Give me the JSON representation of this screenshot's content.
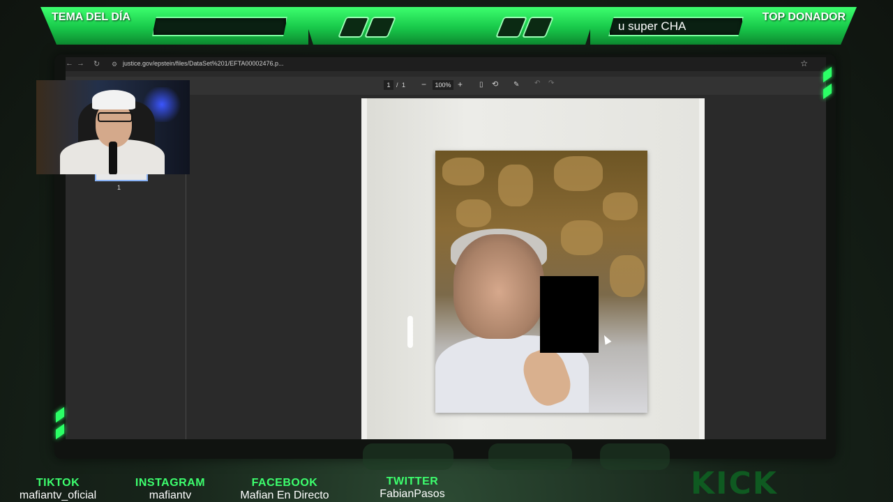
{
  "overlay": {
    "left_label": "TEMA DEL DÍA",
    "right_label": "TOP DONADOR",
    "ticker_text": "u super CHA"
  },
  "browser": {
    "url": "justice.gov/epstein/files/DataSet%201/EFTA00002476.p...",
    "nav_back": "←",
    "nav_forward": "→",
    "reload": "↻",
    "bookmark": "☆"
  },
  "pdf_viewer": {
    "current_page": "1",
    "page_sep": "/",
    "total_pages": "1",
    "zoom_out": "−",
    "zoom": "100%",
    "zoom_in": "+",
    "thumbnail_number": "1",
    "undo": "↶",
    "redo": "↷"
  },
  "socials": [
    {
      "label": "TIKTOK",
      "handle": "mafiantv_oficial"
    },
    {
      "label": "INSTAGRAM",
      "handle": "mafiantv"
    },
    {
      "label": "FACEBOOK",
      "handle": "Mafian En Directo"
    },
    {
      "label": "TWITTER",
      "handle": "FabianPasos"
    }
  ],
  "brand": {
    "kick": "KICK"
  },
  "colors": {
    "accent": "#2bff66",
    "dark": "#2a2a2a"
  }
}
